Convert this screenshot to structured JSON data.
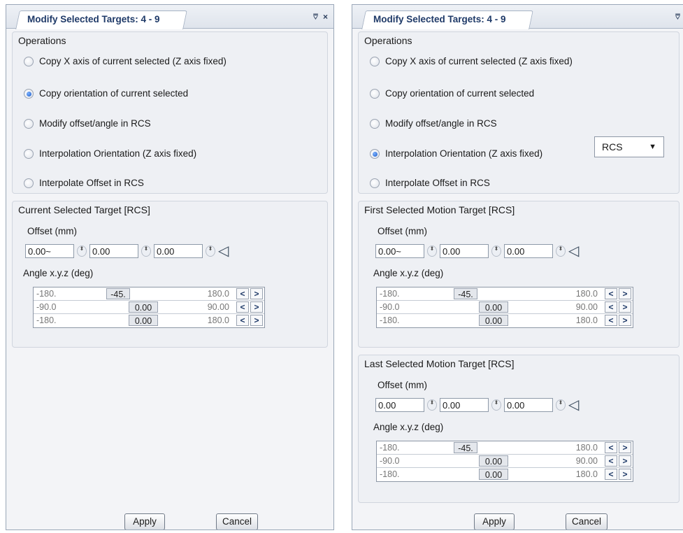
{
  "left_panel": {
    "title": "Modify Selected Targets: 4 - 9",
    "pin": "⩢",
    "close": "×",
    "operations": {
      "title": "Operations",
      "options": [
        {
          "label": "Copy X axis of current selected (Z axis fixed)",
          "selected": false
        },
        {
          "label": "Copy orientation of current selected",
          "selected": true
        },
        {
          "label": "Modify offset/angle in RCS",
          "selected": false
        },
        {
          "label": "Interpolation Orientation (Z axis fixed)",
          "selected": false
        },
        {
          "label": "Interpolate Offset in RCS",
          "selected": false
        }
      ]
    },
    "target": {
      "title": "Current Selected Target [RCS]",
      "offset_label": "Offset (mm)",
      "offsets": [
        "0.00~",
        "0.00",
        "0.00"
      ],
      "angle_label": "Angle x.y.z (deg)",
      "angles": [
        {
          "min": "-180.",
          "value": "-45.",
          "max": "180.0"
        },
        {
          "min": "-90.0",
          "value": "0.00",
          "max": "90.00"
        },
        {
          "min": "-180.",
          "value": "0.00",
          "max": "180.0"
        }
      ]
    },
    "apply": "Apply",
    "cancel": "Cancel"
  },
  "right_panel": {
    "title": "Modify Selected Targets: 4 - 9",
    "pin": "⩢",
    "close": "×",
    "operations": {
      "title": "Operations",
      "options": [
        {
          "label": "Copy X axis of current selected (Z axis fixed)",
          "selected": false
        },
        {
          "label": "Copy orientation of current selected",
          "selected": false
        },
        {
          "label": "Modify offset/angle in RCS",
          "selected": false
        },
        {
          "label": "Interpolation Orientation (Z axis fixed)",
          "selected": true
        },
        {
          "label": "Interpolate Offset in RCS",
          "selected": false
        }
      ],
      "dropdown_value": "RCS"
    },
    "first_target": {
      "title": "First Selected Motion Target [RCS]",
      "offset_label": "Offset (mm)",
      "offsets": [
        "0.00~",
        "0.00",
        "0.00"
      ],
      "angle_label": "Angle x.y.z (deg)",
      "angles": [
        {
          "min": "-180.",
          "value": "-45.",
          "max": "180.0"
        },
        {
          "min": "-90.0",
          "value": "0.00",
          "max": "90.00"
        },
        {
          "min": "-180.",
          "value": "0.00",
          "max": "180.0"
        }
      ]
    },
    "last_target": {
      "title": "Last Selected Motion Target [RCS]",
      "offset_label": "Offset (mm)",
      "offsets": [
        "0.00",
        "0.00",
        "0.00"
      ],
      "angle_label": "Angle x.y.z (deg)",
      "angles": [
        {
          "min": "-180.",
          "value": "-45.",
          "max": "180.0"
        },
        {
          "min": "-90.0",
          "value": "0.00",
          "max": "90.00"
        },
        {
          "min": "-180.",
          "value": "0.00",
          "max": "180.0"
        }
      ]
    },
    "apply": "Apply",
    "cancel": "Cancel"
  },
  "slider_buttons": {
    "prev": "<",
    "next": ">"
  },
  "spin_glyph": "⬍",
  "point_icon": "◁"
}
